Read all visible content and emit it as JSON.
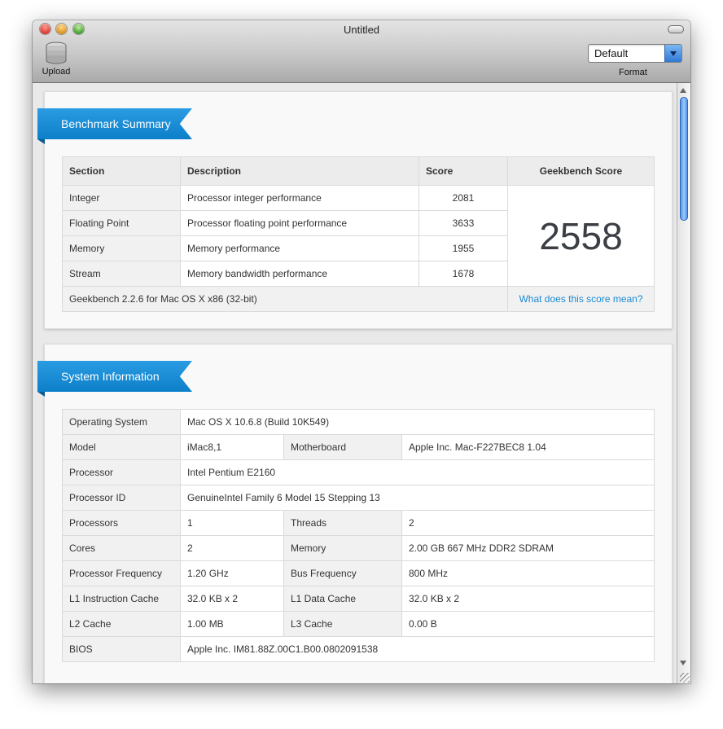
{
  "window": {
    "title": "Untitled"
  },
  "toolbar": {
    "upload_label": "Upload",
    "format_value": "Default",
    "format_label": "Format"
  },
  "benchmark": {
    "heading": "Benchmark Summary",
    "columns": [
      "Section",
      "Description",
      "Score",
      "Geekbench Score"
    ],
    "rows": [
      {
        "section": "Integer",
        "description": "Processor integer performance",
        "score": "2081"
      },
      {
        "section": "Floating Point",
        "description": "Processor floating point performance",
        "score": "3633"
      },
      {
        "section": "Memory",
        "description": "Memory performance",
        "score": "1955"
      },
      {
        "section": "Stream",
        "description": "Memory bandwidth performance",
        "score": "1678"
      }
    ],
    "geekbench_score": "2558",
    "footer_version": "Geekbench 2.2.6 for Mac OS X x86 (32-bit)",
    "footer_link": "What does this score mean?"
  },
  "system": {
    "heading": "System Information",
    "operating_system": {
      "label": "Operating System",
      "value": "Mac OS X 10.6.8 (Build 10K549)"
    },
    "model": {
      "label": "Model",
      "value": "iMac8,1"
    },
    "motherboard": {
      "label": "Motherboard",
      "value": "Apple Inc. Mac-F227BEC8 1.04"
    },
    "processor": {
      "label": "Processor",
      "value": "Intel Pentium E2160"
    },
    "processor_id": {
      "label": "Processor ID",
      "value": "GenuineIntel Family 6 Model 15 Stepping 13"
    },
    "processors": {
      "label": "Processors",
      "value": "1"
    },
    "threads": {
      "label": "Threads",
      "value": "2"
    },
    "cores": {
      "label": "Cores",
      "value": "2"
    },
    "memory": {
      "label": "Memory",
      "value": "2.00 GB 667 MHz DDR2 SDRAM"
    },
    "processor_frequency": {
      "label": "Processor Frequency",
      "value": "1.20 GHz"
    },
    "bus_frequency": {
      "label": "Bus Frequency",
      "value": "800 MHz"
    },
    "l1_instruction_cache": {
      "label": "L1 Instruction Cache",
      "value": "32.0 KB x 2"
    },
    "l1_data_cache": {
      "label": "L1 Data Cache",
      "value": "32.0 KB x 2"
    },
    "l2_cache": {
      "label": "L2 Cache",
      "value": "1.00 MB"
    },
    "l3_cache": {
      "label": "L3 Cache",
      "value": "0.00 B"
    },
    "bios": {
      "label": "BIOS",
      "value": "Apple Inc. IM81.88Z.00C1.B00.0802091538"
    }
  },
  "colors": {
    "ribbon": "#1a8fd9",
    "link": "#1a8ad6",
    "scroll_thumb": "#3f88e8"
  },
  "icons": [
    "database-upload-icon",
    "chevron-down-icon"
  ]
}
